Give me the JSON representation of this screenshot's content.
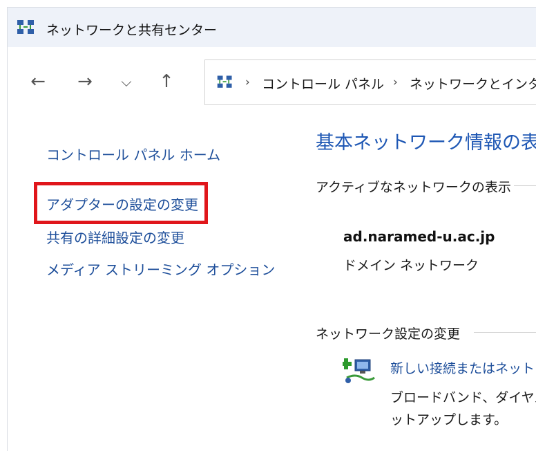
{
  "window": {
    "title": "ネットワークと共有センター"
  },
  "nav": {
    "back_glyph": "←",
    "forward_glyph": "→",
    "recent_glyph": "⌵",
    "up_glyph": "↑"
  },
  "address": {
    "sep": "›",
    "crumbs": [
      "コントロール パネル",
      "ネットワークとインター"
    ]
  },
  "sidebar": {
    "items": [
      {
        "label": "コントロール パネル ホーム"
      },
      {
        "label": "アダプターの設定の変更"
      },
      {
        "label": "共有の詳細設定の変更"
      },
      {
        "label": "メディア ストリーミング オプション"
      }
    ]
  },
  "main": {
    "title": "基本ネットワーク情報の表",
    "active_section": "アクティブなネットワークの表示",
    "network": {
      "name": "ad.naramed-u.ac.jp",
      "type": "ドメイン ネットワーク"
    },
    "settings_section": "ネットワーク設定の変更",
    "task": {
      "link": "新しい接続またはネット",
      "desc_line1": "ブロードバンド、ダイヤル",
      "desc_line2": "ットアップします。"
    }
  },
  "colors": {
    "link": "#1d4e9a",
    "title": "#1e57b4",
    "highlight": "#e0161b"
  }
}
